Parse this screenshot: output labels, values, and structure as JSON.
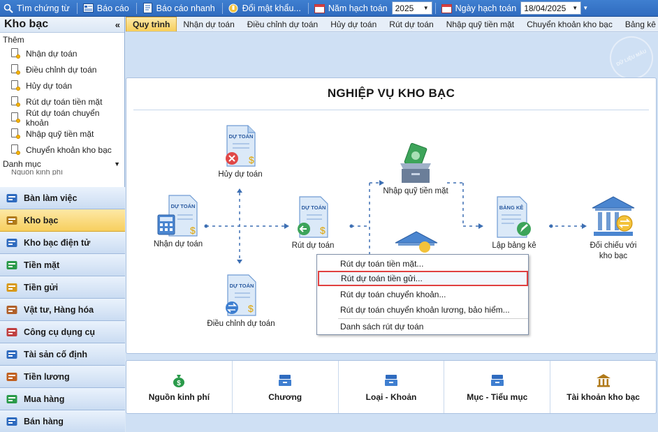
{
  "toolbar": {
    "items": [
      {
        "label": "Tìm chứng từ",
        "icon": "search-icon"
      },
      {
        "label": "Báo cáo",
        "icon": "report-icon"
      },
      {
        "label": "Báo cáo nhanh",
        "icon": "quick-report-icon"
      },
      {
        "label": "Đổi mật khẩu...",
        "icon": "key-icon"
      },
      {
        "label": "Năm hạch toán",
        "icon": "calendar-icon"
      },
      {
        "label": "Ngày hạch toán",
        "icon": "calendar-icon"
      }
    ],
    "year_value": "2025",
    "date_value": "18/04/2025"
  },
  "sidebar": {
    "title": "Kho bạc",
    "collapse": "«",
    "them_label": "Thêm",
    "items": [
      "Nhận dự toán",
      "Điều chỉnh dự toán",
      "Hủy dự toán",
      "Rút dự toán tiền mặt",
      "Rút dự toán chuyển khoản",
      "Nhập quỹ tiền mặt",
      "Chuyển khoản kho bạc"
    ],
    "danh_muc_label": "Danh mục",
    "danh_muc_partial": "Nguồn kinh phí"
  },
  "modules": [
    {
      "label": "Bàn làm việc",
      "icon": "desktop-icon",
      "color": "#2f6bbf"
    },
    {
      "label": "Kho bạc",
      "icon": "treasury-icon",
      "color": "#b07a1a",
      "active": true
    },
    {
      "label": "Kho bạc điện tử",
      "icon": "e-treasury-icon",
      "color": "#2f6bbf"
    },
    {
      "label": "Tiền mặt",
      "icon": "cash-icon",
      "color": "#2a9a4a"
    },
    {
      "label": "Tiền gửi",
      "icon": "deposit-icon",
      "color": "#d89a1a"
    },
    {
      "label": "Vật tư, Hàng hóa",
      "icon": "goods-icon",
      "color": "#b0602a"
    },
    {
      "label": "Công cụ dụng cụ",
      "icon": "tools-icon",
      "color": "#c04040"
    },
    {
      "label": "Tài sản cố định",
      "icon": "assets-icon",
      "color": "#2f6bbf"
    },
    {
      "label": "Tiền lương",
      "icon": "salary-icon",
      "color": "#c06020"
    },
    {
      "label": "Mua hàng",
      "icon": "cart-icon",
      "color": "#2a9a4a"
    },
    {
      "label": "Bán hàng",
      "icon": "sales-icon",
      "color": "#2f6bbf"
    }
  ],
  "tabs": [
    "Quy trình",
    "Nhận dự toán",
    "Điều chỉnh dự toán",
    "Hủy dự toán",
    "Rút dự toán",
    "Nhập quỹ tiền mặt",
    "Chuyển khoản kho bạc",
    "Bảng kê chứng từ thanh toán"
  ],
  "stamp_text": "DỮ LIỆU MẪU",
  "workflow": {
    "title": "NGHIỆP VỤ KHO BẠC",
    "doc_header": "DỰ TOÁN",
    "bang_ke_header": "BẢNG KÊ",
    "nodes": {
      "huy": "Hủy dự toán",
      "nhan": "Nhận dự toán",
      "rut": "Rút dự toán",
      "dieu_chinh": "Điều chỉnh dự toán",
      "nhap_quy": "Nhập quỹ tiền mặt",
      "lap_bang_ke": "Lập bảng kê",
      "doi_chieu_1": "Đối chiếu với",
      "doi_chieu_2": "kho bạc"
    }
  },
  "context_menu": {
    "items": [
      "Rút dự toán tiền mặt...",
      "Rút dự toán tiền gửi...",
      "Rút dự toán chuyển khoản...",
      "Rút dự toán chuyển khoản lương, bảo hiểm...",
      "Danh sách rút dự toán"
    ],
    "highlighted_index": 1
  },
  "categories": [
    {
      "label": "Nguồn kinh phí",
      "icon": "money-bag-icon"
    },
    {
      "label": "Chương",
      "icon": "tray-icon"
    },
    {
      "label": "Loại - Khoản",
      "icon": "tray-icon"
    },
    {
      "label": "Mục - Tiểu mục",
      "icon": "tray-icon"
    },
    {
      "label": "Tài khoản kho bạc",
      "icon": "bank-icon"
    }
  ]
}
